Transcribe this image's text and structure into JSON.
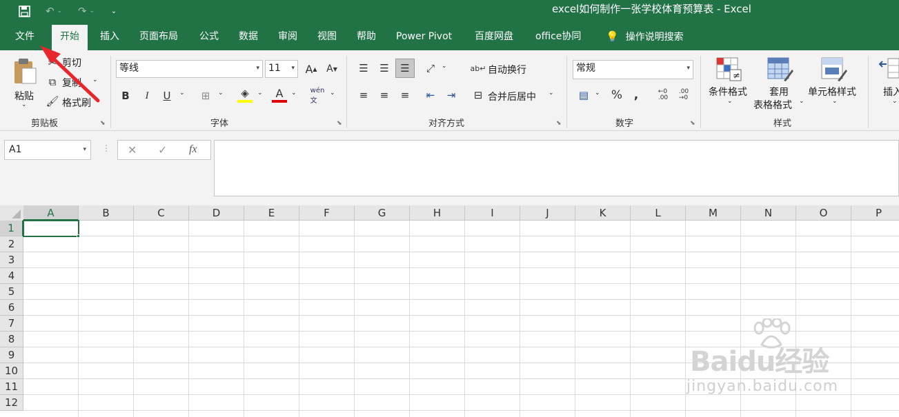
{
  "window": {
    "title": "excel如何制作一张学校体育预算表  -  Excel"
  },
  "quick_access": {
    "save_icon": "save-icon",
    "undo_icon": "undo-icon",
    "redo_icon": "redo-icon",
    "more_icon": "customize-quick-access-icon"
  },
  "tabs": [
    "文件",
    "开始",
    "插入",
    "页面布局",
    "公式",
    "数据",
    "审阅",
    "视图",
    "帮助",
    "Power Pivot",
    "百度网盘",
    "office协同"
  ],
  "tell_me": "操作说明搜索",
  "clipboard": {
    "paste": "粘贴",
    "cut": "剪切",
    "copy": "复制",
    "format_painter": "格式刷",
    "label": "剪贴板"
  },
  "font": {
    "name": "等线",
    "size": "11",
    "bold": "B",
    "italic": "I",
    "underline": "U",
    "label": "字体"
  },
  "alignment": {
    "wrap": "自动换行",
    "merge": "合并后居中",
    "label": "对齐方式"
  },
  "number": {
    "format": "常规",
    "percent": "%",
    "comma": ",",
    "label": "数字"
  },
  "styles": {
    "conditional": "条件格式",
    "table1": "套用",
    "table2": "表格格式",
    "cell_styles": "单元格样式",
    "label": "样式"
  },
  "cells": {
    "insert": "插入"
  },
  "formula_bar": {
    "name_box": "A1",
    "cancel": "✕",
    "enter": "✓",
    "fx": "fx"
  },
  "sheet": {
    "columns": [
      "A",
      "B",
      "C",
      "D",
      "E",
      "F",
      "G",
      "H",
      "I",
      "J",
      "K",
      "L",
      "M",
      "N",
      "O",
      "P"
    ],
    "rows": [
      "1",
      "2",
      "3",
      "4",
      "5",
      "6",
      "7",
      "8",
      "9",
      "10",
      "11",
      "12"
    ],
    "selected_cell": "A1"
  },
  "watermark": {
    "line1": "Baidu经验",
    "line2": "jingyan.baidu.com"
  },
  "colors": {
    "excel_green": "#217346",
    "annotation_arrow": "#e8262b"
  }
}
